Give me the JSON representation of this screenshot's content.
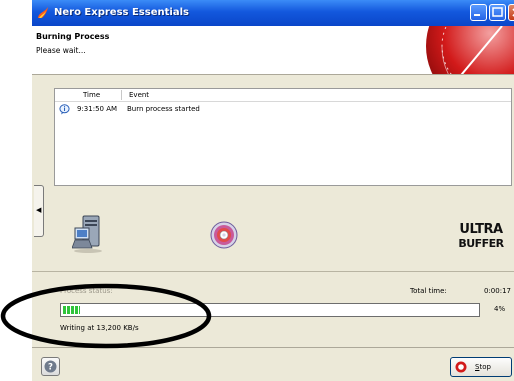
{
  "window": {
    "title": "Nero Express Essentials"
  },
  "header": {
    "title": "Burning Process",
    "subtitle": "Please wait..."
  },
  "log": {
    "columns": {
      "time": "Time",
      "event": "Event"
    },
    "rows": [
      {
        "time": "9:31:50 AM",
        "event": "Burn process started",
        "icon": "info-balloon-icon"
      }
    ]
  },
  "progress": {
    "status_label": "Process status:",
    "total_time_label": "Total time:",
    "total_time_value": "0:00:17",
    "percent_text": "4%",
    "percent_value": 4,
    "writing_text": "Writing at 13,200 KB/s"
  },
  "logo": {
    "alt": "ultra buffer",
    "line1": "ULTRA",
    "line2": "BUFFER"
  },
  "buttons": {
    "stop_label_u": "S",
    "stop_label_rest": "top"
  },
  "colors": {
    "titlebar": "#0a46c9",
    "progress_fill": "#2fc43a",
    "dial_red": "#d21a1a",
    "annotation": "#000000"
  },
  "icons": {
    "app": "nero-flame-icon",
    "computer": "computer-icon",
    "disc": "disc-icon",
    "help": "help-icon",
    "stop": "stop-icon"
  }
}
